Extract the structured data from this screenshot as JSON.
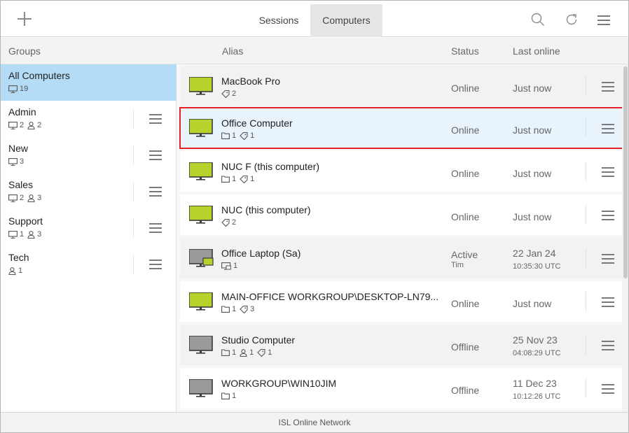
{
  "topbar": {
    "tabs": [
      {
        "label": "Sessions"
      },
      {
        "label": "Computers"
      }
    ]
  },
  "columns": {
    "groups": "Groups",
    "alias": "Alias",
    "status": "Status",
    "last_online": "Last online"
  },
  "groups": [
    {
      "name": "All Computers",
      "computers": "19"
    },
    {
      "name": "Admin",
      "computers": "2",
      "users": "2"
    },
    {
      "name": "New",
      "computers": "3"
    },
    {
      "name": "Sales",
      "computers": "2",
      "users": "3"
    },
    {
      "name": "Support",
      "computers": "1",
      "users": "3"
    },
    {
      "name": "Tech",
      "users": "1"
    }
  ],
  "computers": [
    {
      "alias": "MacBook Pro",
      "tags": "2",
      "status": "Online",
      "last": "Just now"
    },
    {
      "alias": "Office Computer",
      "folders": "1",
      "tags": "1",
      "status": "Online",
      "last": "Just now"
    },
    {
      "alias": "NUC F (this computer)",
      "folders": "1",
      "tags": "1",
      "status": "Online",
      "last": "Just now"
    },
    {
      "alias": "NUC (this computer)",
      "tags": "2",
      "status": "Online",
      "last": "Just now"
    },
    {
      "alias": "Office Laptop (Sa)",
      "sessions": "1",
      "status": "Active",
      "status_user": "Tim",
      "last": "22 Jan 24",
      "last_time": "10:35:30 UTC"
    },
    {
      "alias": "MAIN-OFFICE WORKGROUP\\DESKTOP-LN79...",
      "folders": "1",
      "tags": "3",
      "status": "Online",
      "last": "Just now"
    },
    {
      "alias": "Studio Computer",
      "folders": "1",
      "users": "1",
      "tags": "1",
      "status": "Offline",
      "last": "25 Nov 23",
      "last_time": "04:08:29 UTC"
    },
    {
      "alias": "WORKGROUP\\WIN10JIM",
      "folders": "1",
      "status": "Offline",
      "last": "11 Dec 23",
      "last_time": "10:12:26 UTC"
    }
  ],
  "footer": "ISL Online Network",
  "colors": {
    "online_monitor": "#b5d22d",
    "offline_monitor": "#9a9a9a",
    "selected_group": "#b4dcf6",
    "selected_row_outline": "#e3202a"
  }
}
